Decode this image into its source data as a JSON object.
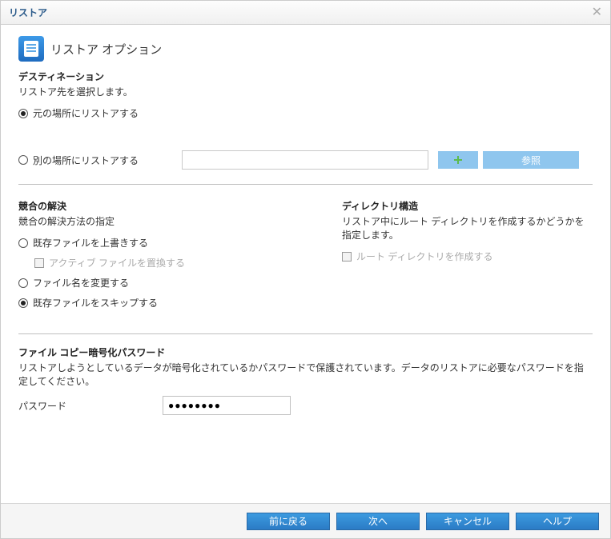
{
  "titlebar": {
    "title": "リストア"
  },
  "header": {
    "title": "リストア オプション"
  },
  "destination": {
    "heading": "デスティネーション",
    "desc": "リストア先を選択します。",
    "original_label": "元の場所にリストアする",
    "alternate_label": "別の場所にリストアする",
    "browse_label": "参照",
    "path_value": ""
  },
  "conflict": {
    "heading": "競合の解決",
    "desc": "競合の解決方法の指定",
    "overwrite_label": "既存ファイルを上書きする",
    "replace_active_label": "アクティブ ファイルを置換する",
    "rename_label": "ファイル名を変更する",
    "skip_label": "既存ファイルをスキップする"
  },
  "directory": {
    "heading": "ディレクトリ構造",
    "desc": "リストア中にルート ディレクトリを作成するかどうかを指定します。",
    "create_root_label": "ルート ディレクトリを作成する"
  },
  "password_section": {
    "heading": "ファイル コピー暗号化パスワード",
    "desc": "リストアしようとしているデータが暗号化されているかパスワードで保護されています。データのリストアに必要なパスワードを指定してください。",
    "label": "パスワード",
    "value": "●●●●●●●●"
  },
  "footer": {
    "back": "前に戻る",
    "next": "次へ",
    "cancel": "キャンセル",
    "help": "ヘルプ"
  }
}
